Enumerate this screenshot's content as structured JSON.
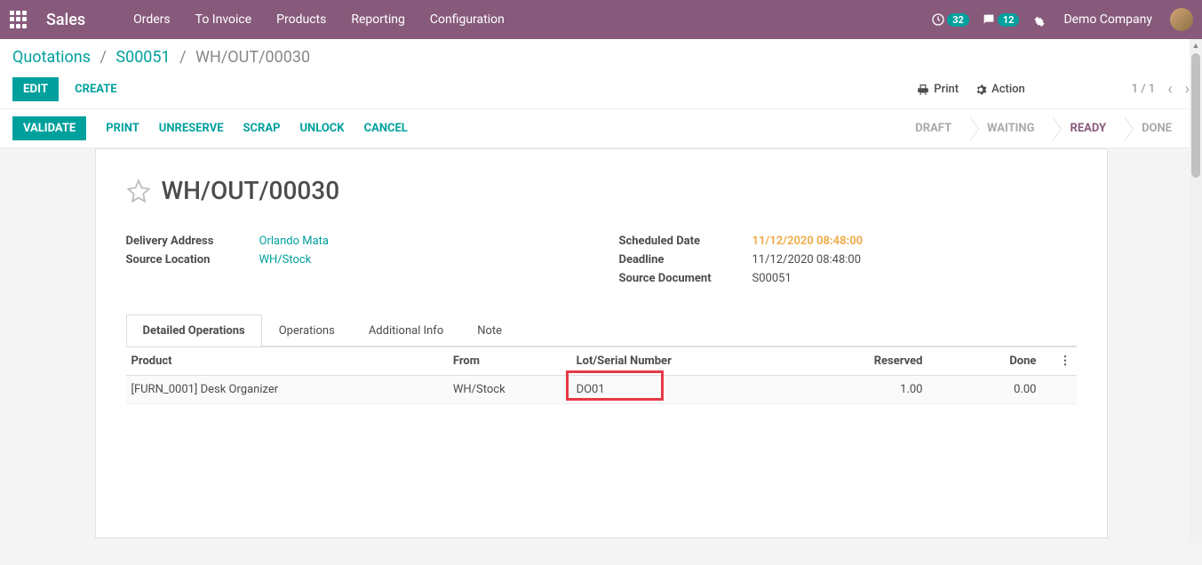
{
  "navbar": {
    "brand": "Sales",
    "menu": [
      "Orders",
      "To Invoice",
      "Products",
      "Reporting",
      "Configuration"
    ],
    "activity_badge": "32",
    "chat_badge": "12",
    "company": "Demo Company"
  },
  "breadcrumb": {
    "items": [
      "Quotations",
      "S00051"
    ],
    "current": "WH/OUT/00030"
  },
  "controls": {
    "edit": "EDIT",
    "create": "CREATE",
    "print": "Print",
    "action": "Action",
    "pager": "1 / 1"
  },
  "status": {
    "validate": "VALIDATE",
    "actions": [
      "PRINT",
      "UNRESERVE",
      "SCRAP",
      "UNLOCK",
      "CANCEL"
    ],
    "stages": [
      "DRAFT",
      "WAITING",
      "READY",
      "DONE"
    ],
    "active_index": 2
  },
  "record": {
    "title": "WH/OUT/00030",
    "left": [
      {
        "label": "Delivery Address",
        "value": "Orlando Mata",
        "link": true
      },
      {
        "label": "Source Location",
        "value": "WH/Stock",
        "link": true
      }
    ],
    "right": [
      {
        "label": "Scheduled Date",
        "value": "11/12/2020 08:48:00",
        "warn": true
      },
      {
        "label": "Deadline",
        "value": "11/12/2020 08:48:00"
      },
      {
        "label": "Source Document",
        "value": "S00051"
      }
    ]
  },
  "tabs": [
    "Detailed Operations",
    "Operations",
    "Additional Info",
    "Note"
  ],
  "table": {
    "headers": [
      "Product",
      "From",
      "Lot/Serial Number",
      "Reserved",
      "Done"
    ],
    "row": {
      "product": "[FURN_0001] Desk Organizer",
      "from": "WH/Stock",
      "lot": "DO01",
      "reserved": "1.00",
      "done": "0.00"
    }
  }
}
